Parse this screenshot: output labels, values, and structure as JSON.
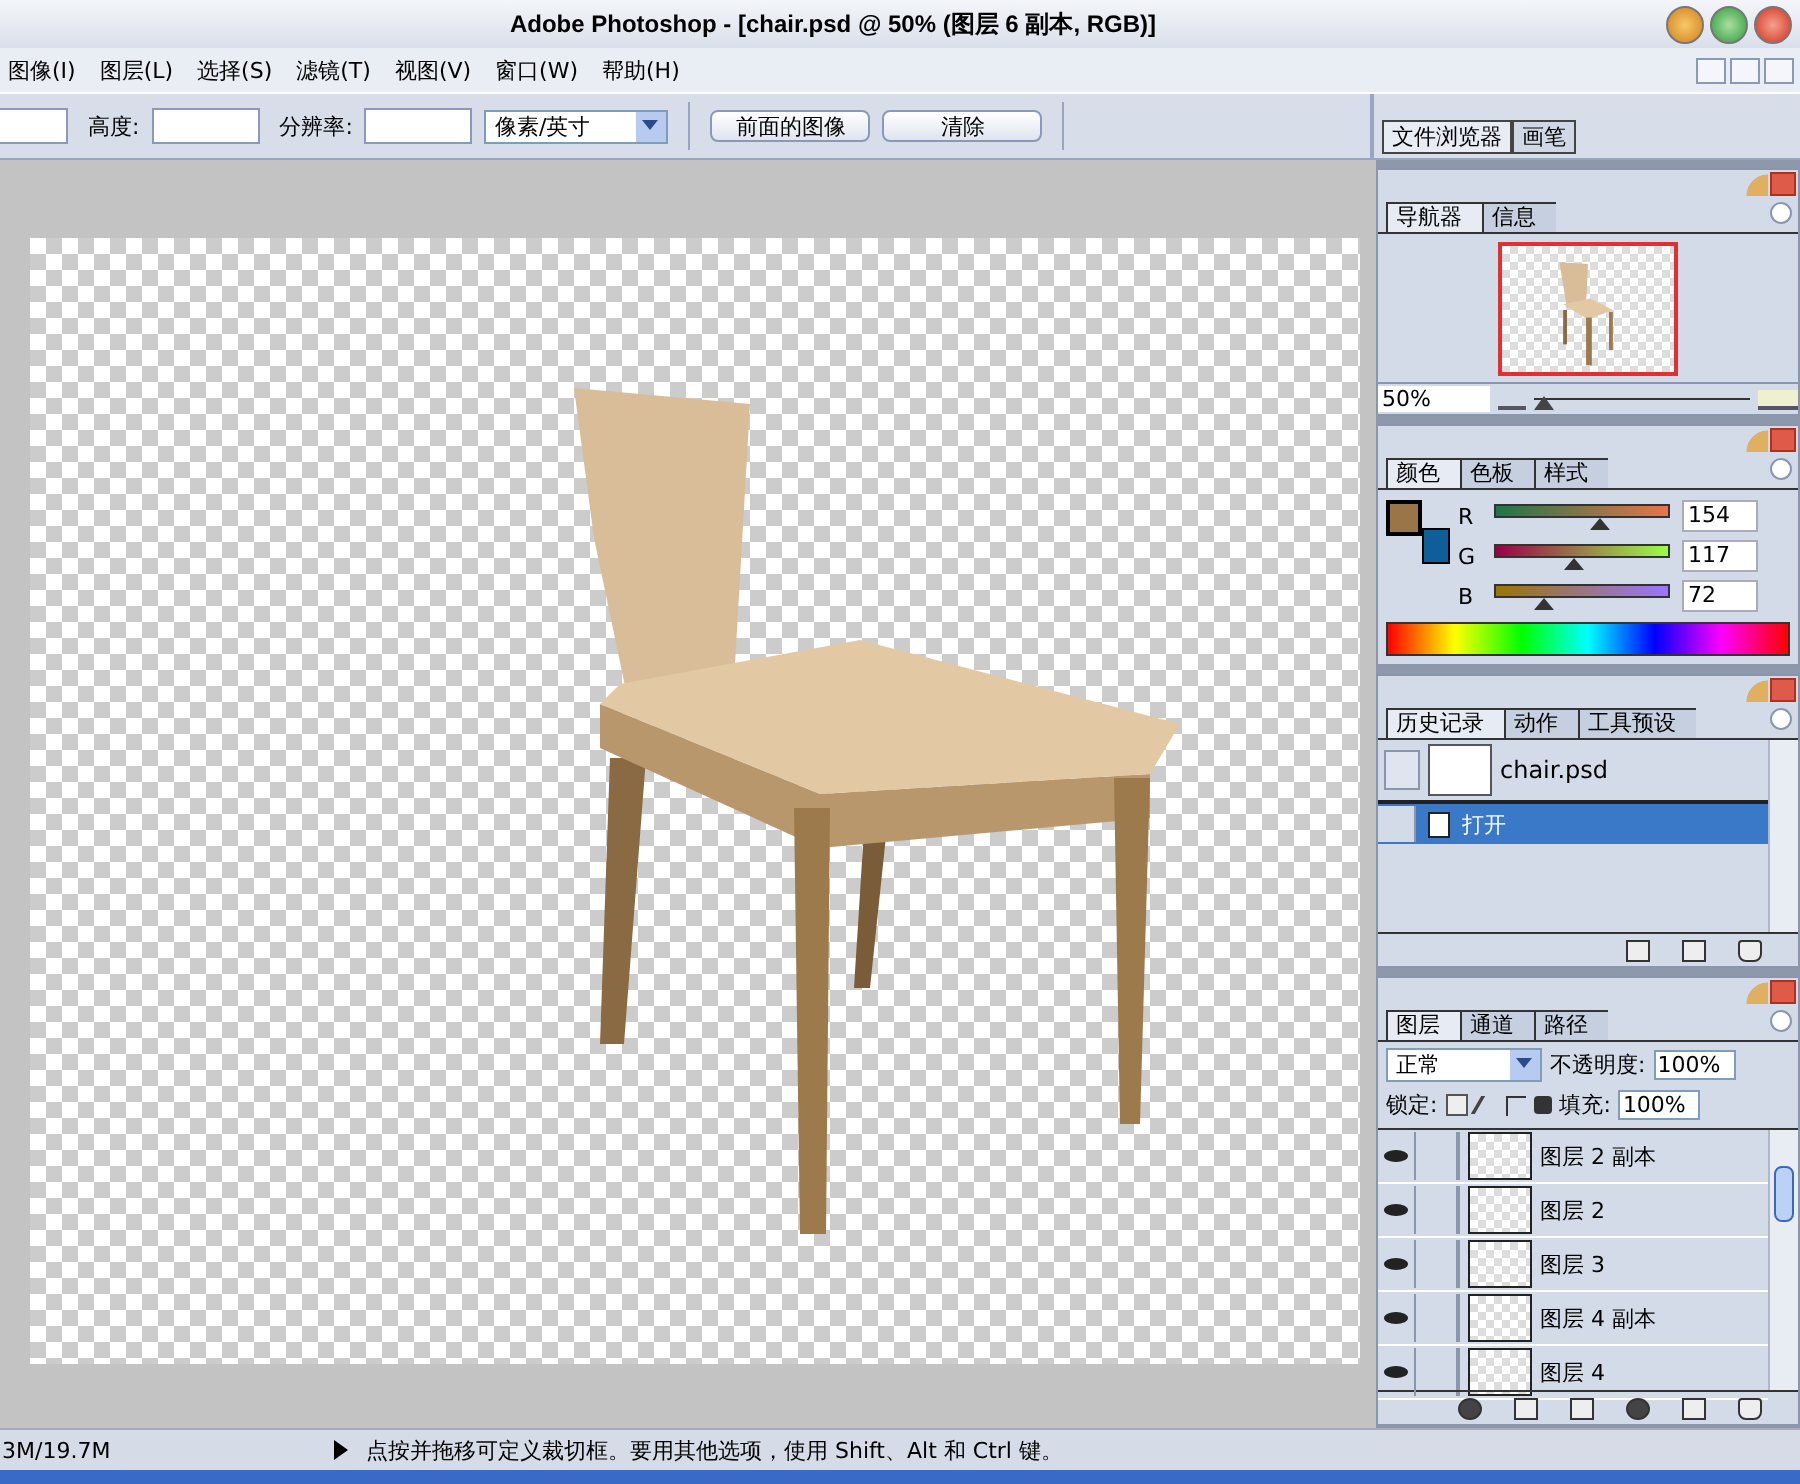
{
  "window": {
    "title": "Adobe Photoshop - [chair.psd @ 50% (图层 6 副本, RGB)]"
  },
  "menu": [
    "图像(I)",
    "图层(L)",
    "选择(S)",
    "滤镜(T)",
    "视图(V)",
    "窗口(W)",
    "帮助(H)"
  ],
  "options_bar": {
    "fields": [
      {
        "label": "高度:"
      },
      {
        "label": "分辨率:"
      }
    ],
    "unit_select": "像素/英寸",
    "buttons": [
      "前面的图像",
      "清除"
    ],
    "palette_well_tabs": [
      {
        "label": "文件浏览器",
        "selected": true
      },
      {
        "label": "画笔",
        "selected": false
      }
    ]
  },
  "navigator": {
    "tabs": [
      {
        "label": "导航器",
        "selected": true
      },
      {
        "label": "信息",
        "selected": false
      }
    ],
    "zoom": "50%",
    "level": 0.05
  },
  "color": {
    "tabs": [
      {
        "label": "颜色",
        "selected": true
      },
      {
        "label": "色板",
        "selected": false
      },
      {
        "label": "样式",
        "selected": false
      }
    ],
    "channels": [
      {
        "name": "R",
        "value": "154",
        "level": 0.6
      },
      {
        "name": "G",
        "value": "117",
        "level": 0.46
      },
      {
        "name": "B",
        "value": "72",
        "level": 0.28
      }
    ]
  },
  "history": {
    "tabs": [
      {
        "label": "历史记录",
        "selected": true
      },
      {
        "label": "动作",
        "selected": false
      },
      {
        "label": "工具预设",
        "selected": false
      }
    ],
    "snapshot": "chair.psd",
    "states": [
      {
        "label": "打开",
        "selected": true
      }
    ]
  },
  "layers": {
    "tabs": [
      {
        "label": "图层",
        "selected": true
      },
      {
        "label": "通道",
        "selected": false
      },
      {
        "label": "路径",
        "selected": false
      }
    ],
    "blend_mode": "正常",
    "opacity_label": "不透明度:",
    "opacity": "100%",
    "lock_label": "锁定:",
    "fill_label": "填充:",
    "fill": "100%",
    "items": [
      {
        "name": "图层 2 副本",
        "visible": true
      },
      {
        "name": "图层 2",
        "visible": true
      },
      {
        "name": "图层 3",
        "visible": true
      },
      {
        "name": "图层 4 副本",
        "visible": true
      },
      {
        "name": "图层 4",
        "visible": true
      }
    ]
  },
  "status_bar": {
    "doc_size": "3M/19.7M",
    "message": "点按并拖移可定义裁切框。要用其他选项，使用 Shift、Alt 和 Ctrl 键。"
  }
}
